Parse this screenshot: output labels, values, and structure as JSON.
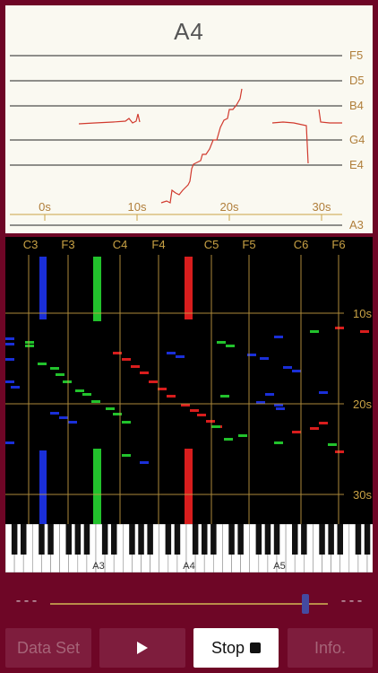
{
  "pitch_panel": {
    "current_note": "A4",
    "note_lines": [
      "F5",
      "D5",
      "B4",
      "G4",
      "E4",
      "A3"
    ],
    "time_labels": [
      "0s",
      "10s",
      "20s",
      "30s"
    ],
    "trace_color": "#d13a2e"
  },
  "spectrogram": {
    "note_labels": [
      "C3",
      "F3",
      "C4",
      "F4",
      "C5",
      "F5",
      "C6",
      "F6"
    ],
    "time_labels": [
      "10s",
      "20s",
      "30s"
    ],
    "grid_color": "#c9a245"
  },
  "keyboard": {
    "labels": [
      "A3",
      "A4",
      "A5"
    ]
  },
  "controls": {
    "left_readout": "---",
    "right_readout": "---",
    "playback_position": 0.92
  },
  "buttons": {
    "data_set": "Data Set",
    "play_icon": "play-icon",
    "stop": "Stop",
    "info": "Info."
  }
}
